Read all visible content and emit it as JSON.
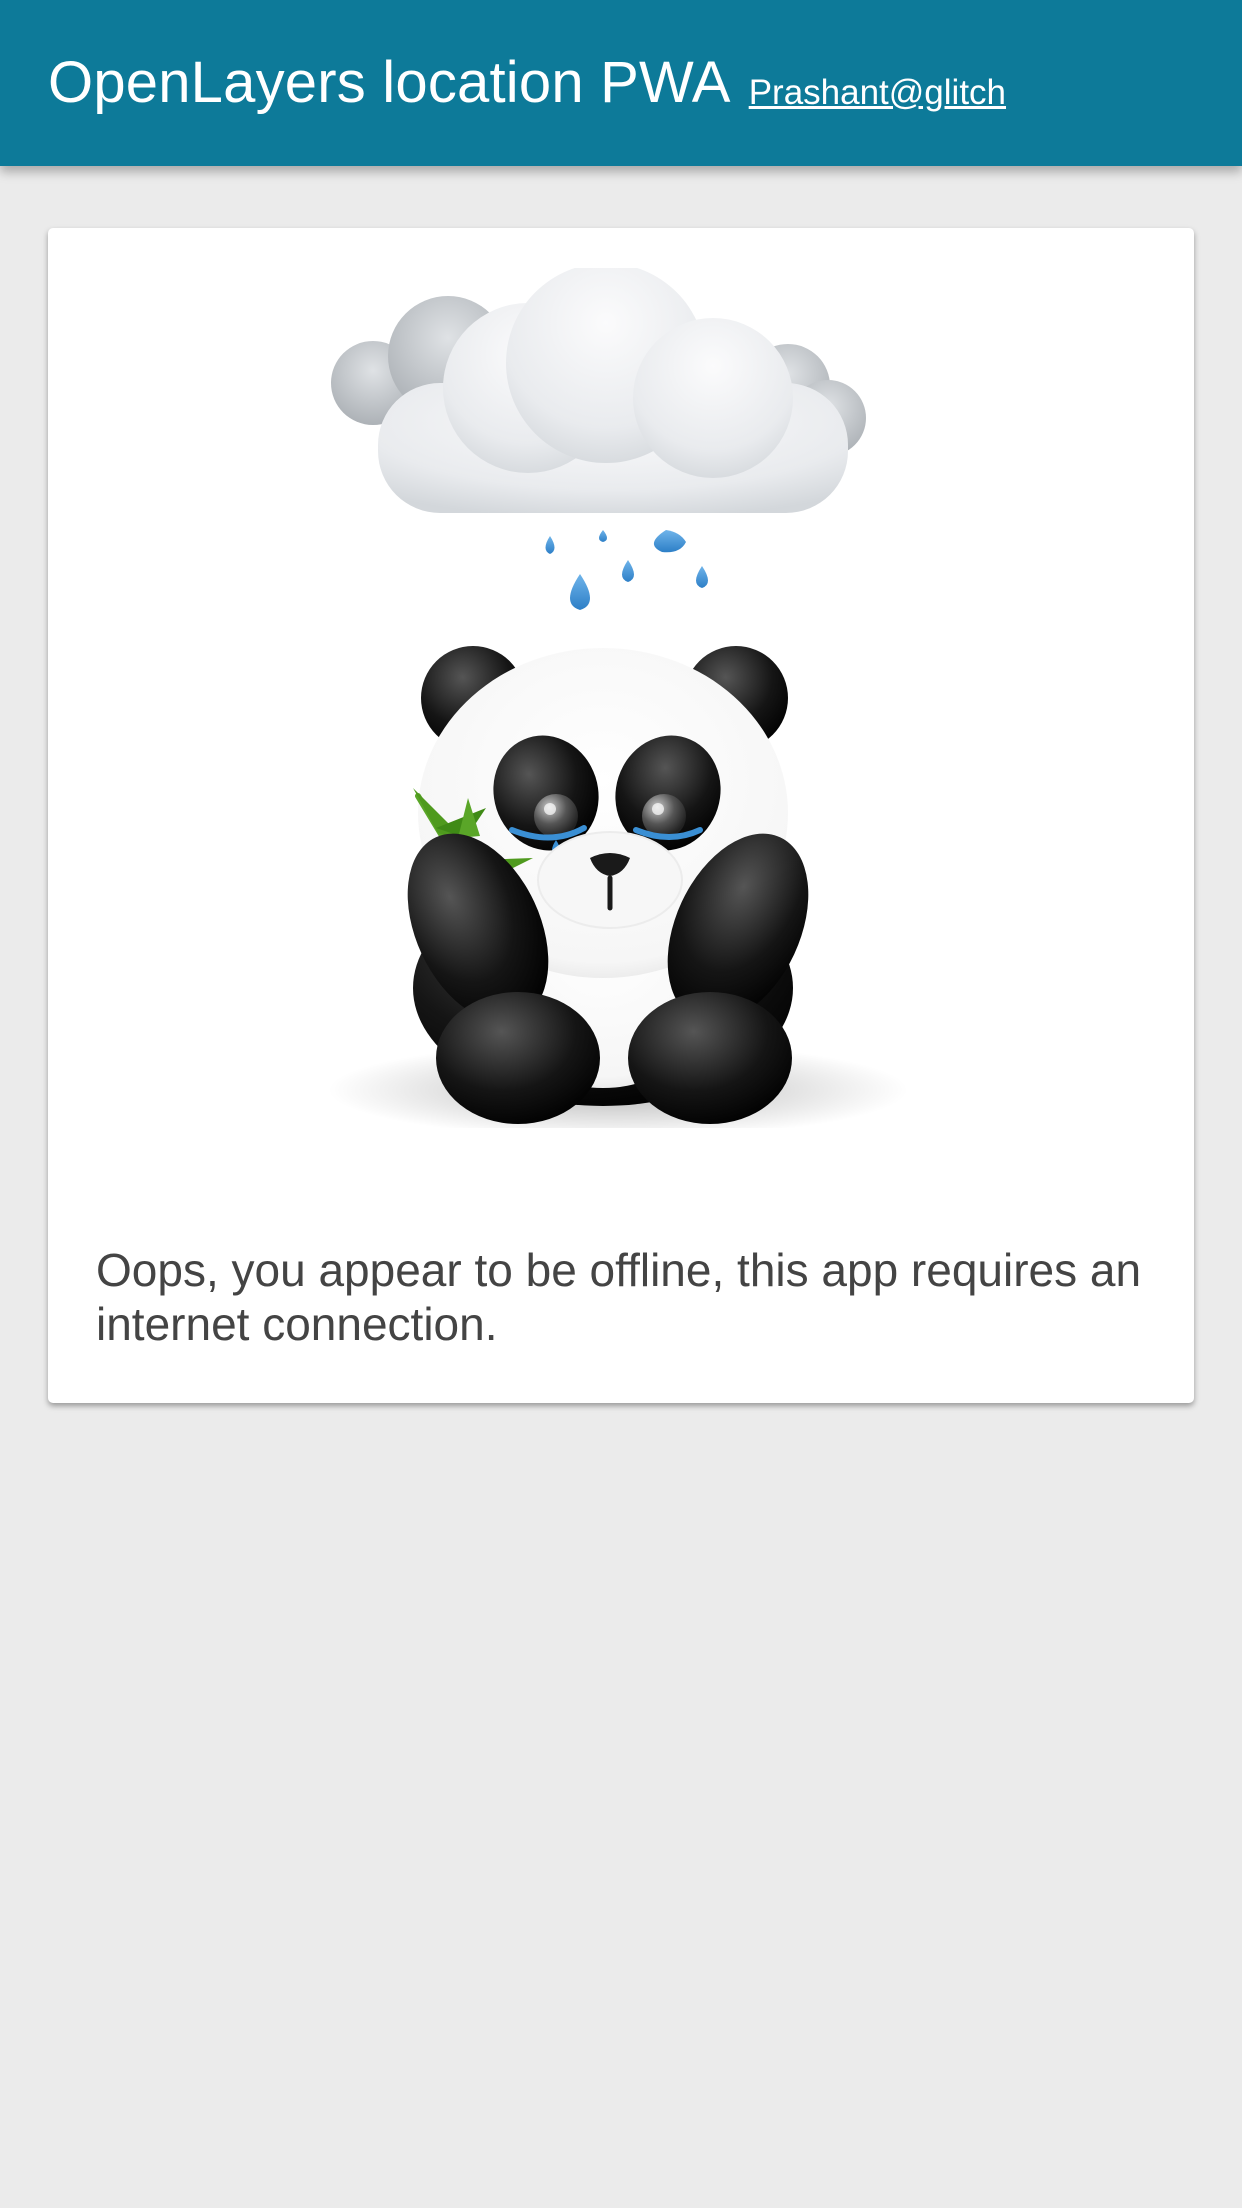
{
  "header": {
    "title": "OpenLayers location PWA",
    "author_link": "Prashant@glitch",
    "background_color": "#0d7a99"
  },
  "offline_card": {
    "illustration": "crying-panda-under-rain-cloud",
    "message": "Oops, you appear to be offline, this app requires an internet connection."
  },
  "colors": {
    "page_background": "#ebebeb",
    "card_background": "#ffffff",
    "text": "#444444",
    "raindrop": "#3a8fd4",
    "bamboo": "#4f9a1e"
  }
}
